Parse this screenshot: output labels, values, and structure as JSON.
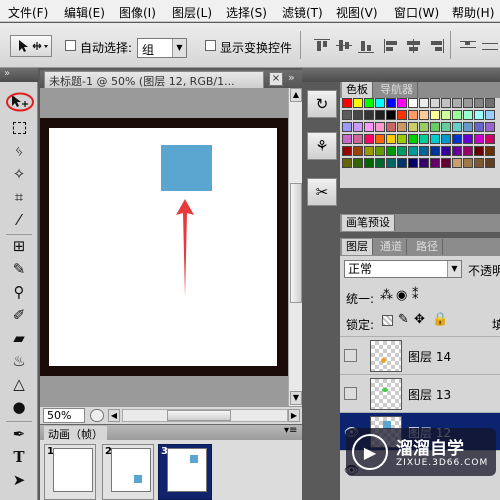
{
  "menubar": {
    "items": [
      "文件(F)",
      "编辑(E)",
      "图像(I)",
      "图层(L)",
      "选择(S)",
      "滤镜(T)",
      "视图(V)",
      "窗口(W)",
      "帮助(H)"
    ]
  },
  "options": {
    "auto_select_label": "自动选择:",
    "auto_select_value": "组",
    "show_transform_label": "显示变换控件"
  },
  "document": {
    "tab_title": "未标题-1 @ 50% (图层 12, RGB/1...",
    "close": "×",
    "zoom": "50%",
    "square_color": "#5ba6d0",
    "arrow_color": "#e83a3a"
  },
  "animation": {
    "title": "动画（帧）",
    "frames": [
      "1",
      "2",
      "3"
    ]
  },
  "panels": {
    "swatches_tab": "色板",
    "navigator_tab": "导航器",
    "brush_preset_tab": "画笔预设",
    "layers_tab": "图层",
    "channels_tab": "通道",
    "paths_tab": "路径",
    "blend_mode": "正常",
    "opacity_label": "不透明",
    "unify_label": "统一:",
    "lock_label": "锁定:",
    "fill_label": "填"
  },
  "layers": [
    {
      "name": "图层 14",
      "dot": "#f0a020"
    },
    {
      "name": "图层 13",
      "dot": "#40d040"
    },
    {
      "name": "图层 12",
      "dot": ""
    }
  ],
  "watermark": {
    "brand": "溜溜自学",
    "url": "ZIXUE.3D66.COM"
  },
  "colors": {
    "highlight_circle": "#e02020",
    "selected_layer": "#0c2470",
    "selected_frame": "#11236a"
  }
}
